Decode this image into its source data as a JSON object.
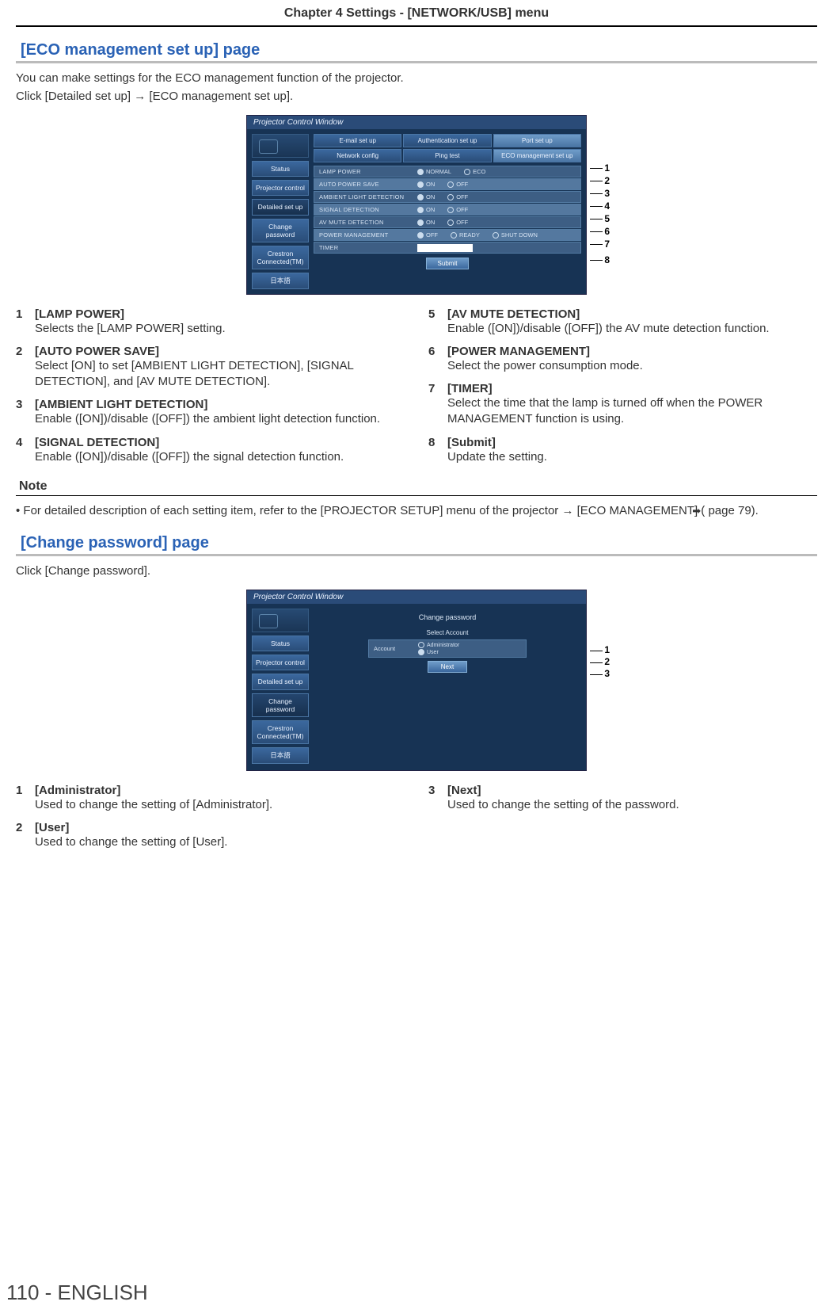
{
  "chapter": "Chapter 4   Settings - [NETWORK/USB] menu",
  "eco": {
    "title": "[ECO management set up] page",
    "intro1": "You can make settings for the ECO management function of the projector.",
    "intro2": "Click [Detailed set up] → [ECO management set up].",
    "window_title": "Projector Control Window",
    "tabs": {
      "r1": [
        "E-mail set up",
        "Authentication set up",
        "Port set up"
      ],
      "r2": [
        "Network config",
        "Ping test",
        "ECO management set up"
      ]
    },
    "side": [
      "Status",
      "Projector control",
      "Detailed set up",
      "Change password",
      "Crestron Connected(TM)",
      "日本語"
    ],
    "rows": [
      {
        "label": "LAMP POWER",
        "opts": [
          "NORMAL",
          "ECO"
        ],
        "sel": 0
      },
      {
        "label": "AUTO POWER SAVE",
        "opts": [
          "ON",
          "OFF"
        ],
        "sel": 0
      },
      {
        "label": "AMBIENT LIGHT DETECTION",
        "opts": [
          "ON",
          "OFF"
        ],
        "sel": 0
      },
      {
        "label": "SIGNAL DETECTION",
        "opts": [
          "ON",
          "OFF"
        ],
        "sel": 0
      },
      {
        "label": "AV MUTE DETECTION",
        "opts": [
          "ON",
          "OFF"
        ],
        "sel": 0
      },
      {
        "label": "POWER MANAGEMENT",
        "opts": [
          "OFF",
          "READY",
          "SHUT DOWN"
        ],
        "sel": 0
      },
      {
        "label": "TIMER",
        "opts": [],
        "sel": -1
      }
    ],
    "submit": "Submit",
    "callouts": [
      "1",
      "2",
      "3",
      "4",
      "5",
      "6",
      "7",
      "8"
    ],
    "items_left": [
      {
        "n": "1",
        "t": "[LAMP POWER]",
        "d": "Selects the [LAMP POWER] setting."
      },
      {
        "n": "2",
        "t": "[AUTO POWER SAVE]",
        "d": "Select [ON] to set [AMBIENT LIGHT DETECTION], [SIGNAL DETECTION], and [AV MUTE DETECTION]."
      },
      {
        "n": "3",
        "t": "[AMBIENT LIGHT DETECTION]",
        "d": "Enable ([ON])/disable ([OFF]) the ambient light detection function."
      },
      {
        "n": "4",
        "t": "[SIGNAL DETECTION]",
        "d": "Enable ([ON])/disable ([OFF]) the signal detection function."
      }
    ],
    "items_right": [
      {
        "n": "5",
        "t": "[AV MUTE DETECTION]",
        "d": "Enable ([ON])/disable ([OFF]) the AV mute detection function."
      },
      {
        "n": "6",
        "t": "[POWER MANAGEMENT]",
        "d": "Select the power consumption mode."
      },
      {
        "n": "7",
        "t": "[TIMER]",
        "d": "Select the time that the lamp is turned off when the POWER MANAGEMENT function is using."
      },
      {
        "n": "8",
        "t": "[Submit]",
        "d": "Update the setting."
      }
    ]
  },
  "note": {
    "head": "Note",
    "body_a": "For detailed description of each setting item, refer to the [PROJECTOR SETUP] menu of the projector → [ECO MANAGEMENT] (",
    "body_b": " page 79)."
  },
  "cp": {
    "title": "[Change password] page",
    "intro": "Click [Change password].",
    "window_title": "Projector Control Window",
    "header": "Change password",
    "select_account": "Select Account",
    "account_label": "Account",
    "acc_opts": [
      "Administrator",
      "User"
    ],
    "next": "Next",
    "side": [
      "Status",
      "Projector control",
      "Detailed set up",
      "Change password",
      "Crestron Connected(TM)",
      "日本語"
    ],
    "callouts": [
      "1",
      "2",
      "3"
    ],
    "items_left": [
      {
        "n": "1",
        "t": "[Administrator]",
        "d": "Used to change the setting of [Administrator]."
      },
      {
        "n": "2",
        "t": "[User]",
        "d": "Used to change the setting of [User]."
      }
    ],
    "items_right": [
      {
        "n": "3",
        "t": "[Next]",
        "d": "Used to change the setting of the password."
      }
    ]
  },
  "footer": "110 - ENGLISH"
}
